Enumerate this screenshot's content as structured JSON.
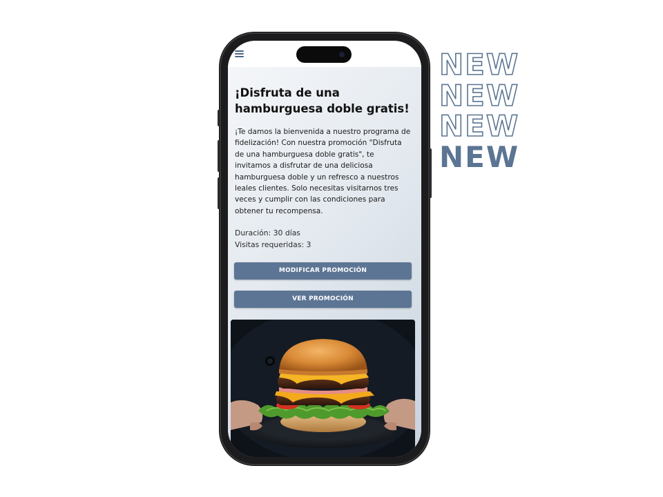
{
  "promo": {
    "title": "¡Disfruta de una hamburguesa doble gratis!",
    "description": "¡Te damos la bienvenida a nuestro programa de fidelización! Con nuestra promoción \"Disfruta de una hamburguesa doble gratis\", te invitamos a disfrutar de una deliciosa hamburguesa doble y un refresco a nuestros leales clientes. Solo necesitas visitarnos tres veces y cumplir con las condiciones para obtener tu recompensa.",
    "duration": "Duración: 30 días",
    "visits": "Visitas requeridas: 3",
    "modify_label": "MODIFICAR PROMOCIÓN",
    "view_label": "VER PROMOCIÓN"
  },
  "topbar": {
    "menu_icon": "hamburger-menu-icon"
  },
  "badge": {
    "words": [
      "NEW",
      "NEW",
      "NEW",
      "NEW"
    ]
  },
  "colors": {
    "accent": "#5d7594",
    "badge": "#5b7593",
    "phone_frame": "#1c1c1e"
  }
}
